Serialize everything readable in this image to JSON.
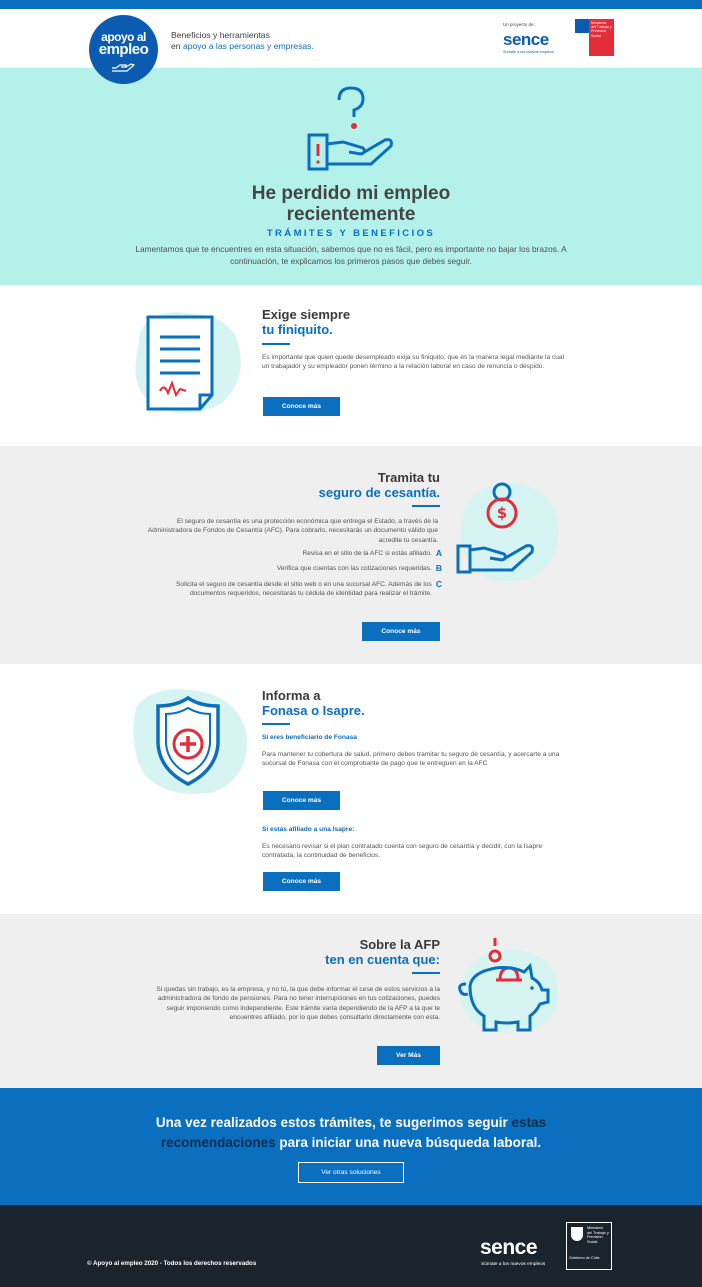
{
  "header": {
    "logo_line1": "apoyo al",
    "logo_line2": "empleo",
    "tagline_1": "Beneficios y herramientas",
    "tagline_2_prefix": "en ",
    "tagline_2_accent": "apoyo a las personas y empresas.",
    "partner_label": "Un proyecto de:",
    "partner_name": "sence",
    "partner_sub": "Súmate a los nuevos empleos",
    "ministry_text": "Ministerio del Trabajo y Previsión Social"
  },
  "hero": {
    "title_line1": "He perdido mi empleo",
    "title_line2": "recientemente",
    "subtitle": "TRÁMITES Y BENEFICIOS",
    "body": "Lamentamos que te encuentres en esta situación, sabemos que no es fácil, pero es importante no bajar los brazos. A continuación, te explicamos los primeros pasos que debes seguir."
  },
  "finiquito": {
    "title_dark": "Exige siempre",
    "title_blue": "tu finiquito.",
    "body": "Es importante que quien quede desempleado exija su finiquito, que es la manera legal mediante la cual un trabajador y su empleador ponen término a la relación laboral en caso de renuncia o despido.",
    "button": "Conoce más"
  },
  "cesantia": {
    "title_dark": "Tramita tu",
    "title_blue": "seguro de cesantía.",
    "body": "El seguro de cesantía es una protección económica que entrega el Estado, a través de la Administradora de Fondos de Cesantía (AFC). Para cobrarlo, necesitarás un documento válido que acredite tu cesantía.",
    "steps": [
      {
        "text": "Revisa en el sitio de la AFC si estás afiliado.",
        "letter": "A"
      },
      {
        "text": "Verifica que cuentas con las cotizaciones requeridas.",
        "letter": "B"
      },
      {
        "text": "Solicita el seguro de cesantía desde el sitio web o en una sucursal AFC. Además de los documentos requeridos, necesitarás tu cédula de identidad para realizar el trámite.",
        "letter": "C"
      }
    ],
    "button": "Conoce más"
  },
  "fonasa": {
    "title_dark": "Informa a",
    "title_blue": "Fonasa o Isapre.",
    "sub1": "Si eres beneficiario de Fonasa",
    "body1": "Para mantener tu cobertura de salud, primero debes tramitar tu seguro de cesantía, y acercarte a una sucursal de Fonasa con el comprobante de pago que te entreguen en la AFC",
    "button1": "Conoce más",
    "sub2": "Si estás afiliado a una Isapre:",
    "body2": "Es necesario revisar si el plan contratado cuenta con seguro de cesantía y decidir, con la Isapre contratada, la continuidad de beneficios.",
    "button2": "Conoce más"
  },
  "afp": {
    "title_dark": "Sobre la AFP",
    "title_blue": "ten en cuenta que:",
    "body": "Si quedas sin trabajo, es la empresa, y no tú, la que debe informar el cese de estos servicios a la administradora de fondo de pensiones. Para no tener interrupciones en tus cotizaciones, puedes seguir imponiendo como independiente. Este trámite varía dependiendo de la AFP a la que te encuentres afiliado, por lo que debes consultarlo directamente con esta.",
    "button": "Ver Más"
  },
  "banner": {
    "text_1": "Una vez realizados estos trámites, te sugerimos seguir ",
    "text_hl1": "estas recomendaciones",
    "text_2": " para iniciar una nueva búsqueda laboral.",
    "button": "Ver otras soluciones"
  },
  "footer": {
    "copyright": "© Apoyo al empleo 2020 - Todos los derechos reservados",
    "partner_name": "sence",
    "partner_sub": "Súmate a los nuevos empleos",
    "ministry_text": "Ministerio del Trabajo y Previsión Social",
    "gov_text": "Gobierno de Chile"
  },
  "colors": {
    "brand_blue": "#0a6fbf",
    "hero_bg": "#b5f1eb",
    "grey_bg": "#efefef",
    "footer_bg": "#1a242d",
    "accent_red": "#e42d38"
  },
  "icons": [
    "question-hand-icon",
    "document-icon",
    "dollar-coin-hand-icon",
    "health-shield-icon",
    "piggy-bank-icon"
  ]
}
